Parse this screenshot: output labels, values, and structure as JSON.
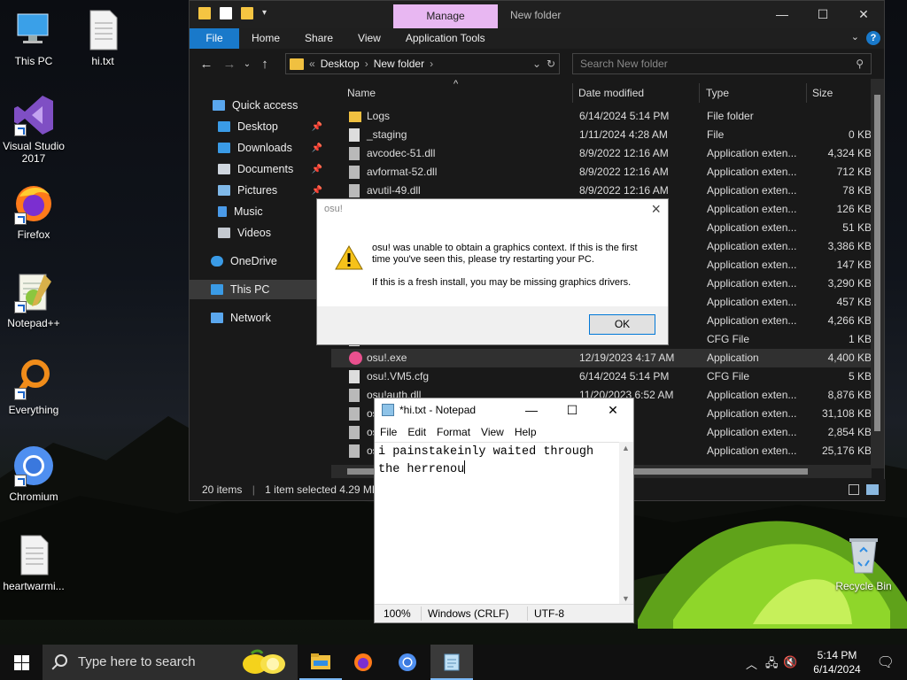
{
  "desktop": {
    "icons": [
      {
        "label": "This PC"
      },
      {
        "label": "hi.txt"
      },
      {
        "label": "Visual Studio 2017"
      },
      {
        "label": "Firefox"
      },
      {
        "label": "Notepad++"
      },
      {
        "label": "Everything"
      },
      {
        "label": "Chromium"
      },
      {
        "label": "heartwarmi..."
      },
      {
        "label": "Recycle Bin"
      }
    ]
  },
  "explorer": {
    "manage_tab": "Manage",
    "title": "New folder",
    "ribbon_tabs": [
      "File",
      "Home",
      "Share",
      "View",
      "Application Tools"
    ],
    "breadcrumb": [
      "Desktop",
      "New folder"
    ],
    "search_placeholder": "Search New folder",
    "nav": {
      "quick_access": "Quick access",
      "desktop": "Desktop",
      "downloads": "Downloads",
      "documents": "Documents",
      "pictures": "Pictures",
      "music": "Music",
      "videos": "Videos",
      "onedrive": "OneDrive",
      "this_pc": "This PC",
      "network": "Network"
    },
    "columns": {
      "name": "Name",
      "date": "Date modified",
      "type": "Type",
      "size": "Size"
    },
    "files": [
      {
        "name": "Logs",
        "date": "6/14/2024 5:14 PM",
        "type": "File folder",
        "size": ""
      },
      {
        "name": "_staging",
        "date": "1/11/2024 4:28 AM",
        "type": "File",
        "size": "0 KB"
      },
      {
        "name": "avcodec-51.dll",
        "date": "8/9/2022 12:16 AM",
        "type": "Application exten...",
        "size": "4,324 KB"
      },
      {
        "name": "avformat-52.dll",
        "date": "8/9/2022 12:16 AM",
        "type": "Application exten...",
        "size": "712 KB"
      },
      {
        "name": "avutil-49.dll",
        "date": "8/9/2022 12:16 AM",
        "type": "Application exten...",
        "size": "78 KB"
      },
      {
        "name": "",
        "date": "",
        "type": "Application exten...",
        "size": "126 KB"
      },
      {
        "name": "",
        "date": "",
        "type": "Application exten...",
        "size": "51 KB"
      },
      {
        "name": "",
        "date": "",
        "type": "Application exten...",
        "size": "3,386 KB"
      },
      {
        "name": "",
        "date": "",
        "type": "Application exten...",
        "size": "147 KB"
      },
      {
        "name": "",
        "date": "",
        "type": "Application exten...",
        "size": "3,290 KB"
      },
      {
        "name": "",
        "date": "",
        "type": "Application exten...",
        "size": "457 KB"
      },
      {
        "name": "",
        "date": "",
        "type": "Application exten...",
        "size": "4,266 KB"
      },
      {
        "name": "",
        "date": "",
        "type": "CFG File",
        "size": "1 KB"
      },
      {
        "name": "osu!.exe",
        "date": "12/19/2023 4:17 AM",
        "type": "Application",
        "size": "4,400 KB"
      },
      {
        "name": "osu!.VM5.cfg",
        "date": "6/14/2024 5:14 PM",
        "type": "CFG File",
        "size": "5 KB"
      },
      {
        "name": "osu!auth.dll",
        "date": "11/20/2023 6:52 AM",
        "type": "Application exten...",
        "size": "8,876 KB"
      },
      {
        "name": "os",
        "date": "16 AM",
        "type": "Application exten...",
        "size": "31,108 KB"
      },
      {
        "name": "os",
        "date": ":49 PM",
        "type": "Application exten...",
        "size": "2,854 KB"
      },
      {
        "name": "os",
        "date": "45 AM",
        "type": "Application exten...",
        "size": "25,176 KB"
      }
    ],
    "status_items": "20 items",
    "status_selected": "1 item selected  4.29 MB"
  },
  "dialog": {
    "title": "osu!",
    "message_1": "osu! was unable to obtain a graphics context. If this is the first time you've seen this, please try restarting your PC.",
    "message_2": "If this is a fresh install, you may be missing graphics drivers.",
    "ok_label": "OK"
  },
  "notepad": {
    "title": "*hi.txt - Notepad",
    "menu": [
      "File",
      "Edit",
      "Format",
      "View",
      "Help"
    ],
    "text": "i painstakeinly waited through\nthe herrenou",
    "status_zoom": "100%",
    "status_eol": "Windows (CRLF)",
    "status_enc": "UTF-8"
  },
  "taskbar": {
    "search_placeholder": "Type here to search",
    "time": "5:14 PM",
    "date": "6/14/2024"
  }
}
